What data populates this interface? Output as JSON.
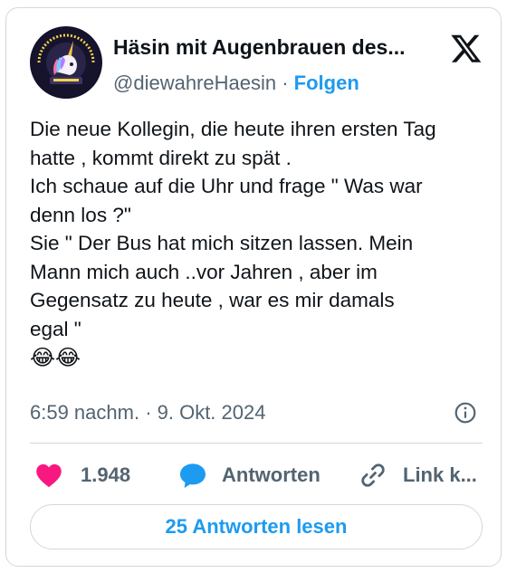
{
  "author": {
    "display_name": "Häsin mit Augenbrauen des...",
    "handle": "@diewahreHaesin",
    "separator": "·",
    "follow_label": "Folgen",
    "avatar_icon": "unicorn-avatar-icon",
    "avatar_text": "ALWAYS BE YOURSELF UNICORN"
  },
  "platform_icon": "x-logo-icon",
  "tweet": {
    "lines": [
      "Die neue Kollegin, die heute ihren ersten Tag",
      "hatte , kommt direkt zu spät .",
      "Ich schaue auf die Uhr und frage \" Was war",
      "denn los ?\"",
      "Sie \" Der Bus hat mich sitzen lassen. Mein",
      "Mann mich auch ..vor Jahren , aber im",
      "Gegensatz zu heute , war es mir damals",
      "egal \""
    ],
    "emoji": "😂😂"
  },
  "meta": {
    "timestamp": "6:59 nachm. · 9. Okt. 2024",
    "info_icon": "info-icon"
  },
  "actions": {
    "like_count": "1.948",
    "reply_label": "Antworten",
    "link_label": "Link k..."
  },
  "read_replies_label": "25 Antworten lesen",
  "colors": {
    "accent": "#1d9bf0",
    "like": "#f91880",
    "muted": "#536471",
    "text": "#0f1419",
    "border": "#cfd9de"
  }
}
